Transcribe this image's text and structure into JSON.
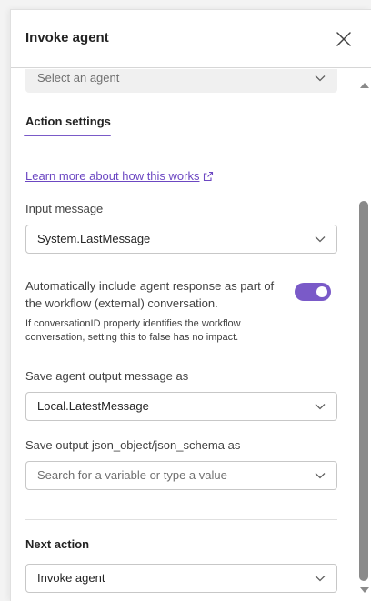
{
  "header": {
    "title": "Invoke agent"
  },
  "agent_select": {
    "placeholder": "Select an agent"
  },
  "tabs": [
    {
      "label": "Action settings",
      "active": true
    }
  ],
  "learn_more": {
    "label": "Learn more about how this works"
  },
  "input_message": {
    "label": "Input message",
    "value": "System.LastMessage"
  },
  "toggle_setting": {
    "label": "Automatically include agent response as part of the workflow (external) conversation.",
    "helper": "If conversationID property identifies the workflow conversation, setting this to false has no impact.",
    "enabled": true
  },
  "save_output": {
    "label": "Save agent output message as",
    "value": "Local.LatestMessage"
  },
  "save_json": {
    "label": "Save output json_object/json_schema as",
    "placeholder": "Search for a variable or type a value"
  },
  "next_action": {
    "label": "Next action",
    "value": "Invoke agent"
  },
  "colors": {
    "accent": "#7a5ac8",
    "link": "#6c47c2"
  }
}
